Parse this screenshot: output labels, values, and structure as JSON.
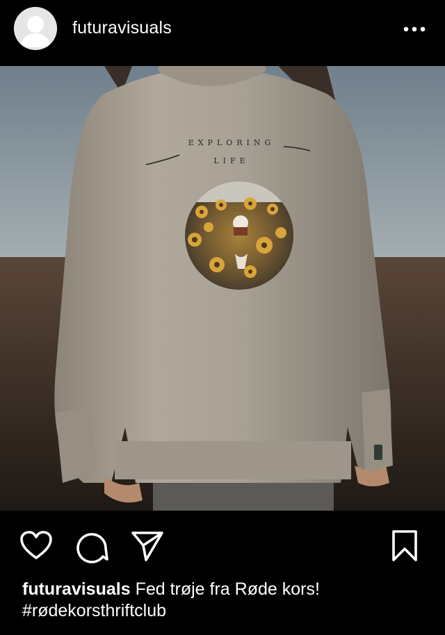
{
  "post": {
    "username": "futuravisuals",
    "image_alt": "Person wearing a grey sweatshirt printed with a sunflower field circle",
    "sweater_print_text": "EXPLORING LIFE",
    "caption_text": "Fed trøje fra Røde kors!",
    "hashtag": "#rødekorsthriftclub"
  },
  "icons": {
    "avatar": "default-avatar-icon",
    "more": "more-options-icon",
    "like": "heart-icon",
    "comment": "comment-icon",
    "share": "send-icon",
    "save": "bookmark-icon"
  },
  "colors": {
    "background": "#000000",
    "text": "#ffffff",
    "avatar_bg": "#e6e6e6"
  }
}
